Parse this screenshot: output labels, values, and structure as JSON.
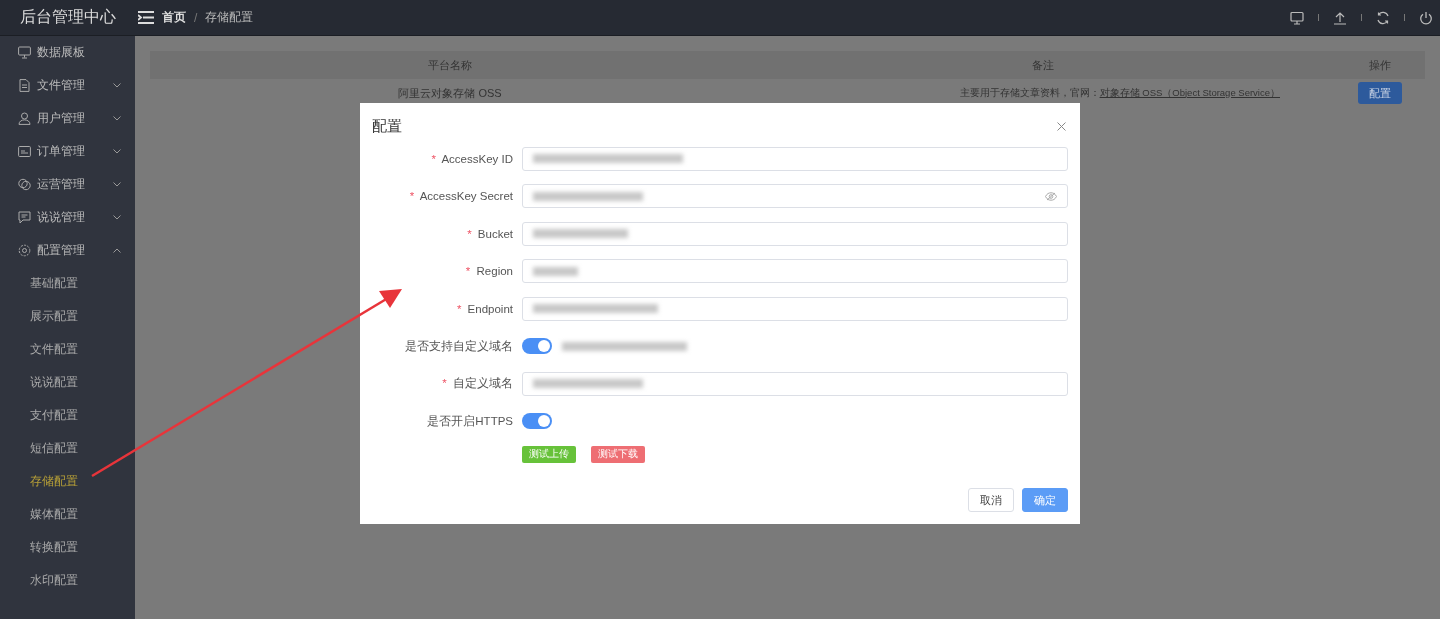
{
  "sidebar": {
    "title": "后台管理中心",
    "items": [
      {
        "label": "数据展板",
        "kind": "link"
      },
      {
        "label": "文件管理",
        "kind": "group",
        "expanded": false
      },
      {
        "label": "用户管理",
        "kind": "group",
        "expanded": false
      },
      {
        "label": "订单管理",
        "kind": "group",
        "expanded": false
      },
      {
        "label": "运营管理",
        "kind": "group",
        "expanded": false
      },
      {
        "label": "说说管理",
        "kind": "group",
        "expanded": false
      },
      {
        "label": "配置管理",
        "kind": "group",
        "expanded": true,
        "children": [
          {
            "label": "基础配置",
            "selected": false
          },
          {
            "label": "展示配置",
            "selected": false
          },
          {
            "label": "文件配置",
            "selected": false
          },
          {
            "label": "说说配置",
            "selected": false
          },
          {
            "label": "支付配置",
            "selected": false
          },
          {
            "label": "短信配置",
            "selected": false
          },
          {
            "label": "存储配置",
            "selected": true
          },
          {
            "label": "媒体配置",
            "selected": false
          },
          {
            "label": "转换配置",
            "selected": false
          },
          {
            "label": "水印配置",
            "selected": false
          }
        ]
      }
    ]
  },
  "header": {
    "breadcrumb": [
      "首页",
      "存储配置"
    ],
    "separator": "/"
  },
  "table": {
    "columns": [
      "平台名称",
      "备注",
      "操作"
    ],
    "rows": [
      {
        "platform": "阿里云对象存储 OSS",
        "note": "主要用于存储文章资料，官网：",
        "link": "对象存储 OSS（Object Storage Service）",
        "action": "配置"
      }
    ]
  },
  "dialog": {
    "title": "配置",
    "fields": [
      {
        "label": "AccessKey ID",
        "mark": "*",
        "kind": "text"
      },
      {
        "label": "AccessKey Secret",
        "mark": "*",
        "kind": "password"
      },
      {
        "label": "Bucket",
        "mark": "*",
        "kind": "text"
      },
      {
        "label": "Region",
        "mark": "*",
        "kind": "text"
      },
      {
        "label": "Endpoint",
        "mark": "*",
        "kind": "text"
      },
      {
        "label": "是否支持自定义域名",
        "kind": "switch",
        "on": true
      },
      {
        "label": "自定义域名",
        "mark": "*",
        "kind": "text"
      },
      {
        "label": "是否开启HTTPS",
        "kind": "switch",
        "on": true
      }
    ],
    "test_buttons": [
      {
        "label": "测试上传",
        "kind": "success"
      },
      {
        "label": "测试下载",
        "kind": "danger"
      }
    ],
    "footer_buttons": [
      {
        "label": "取消",
        "kind": "default"
      },
      {
        "label": "确定",
        "kind": "primary"
      }
    ]
  }
}
